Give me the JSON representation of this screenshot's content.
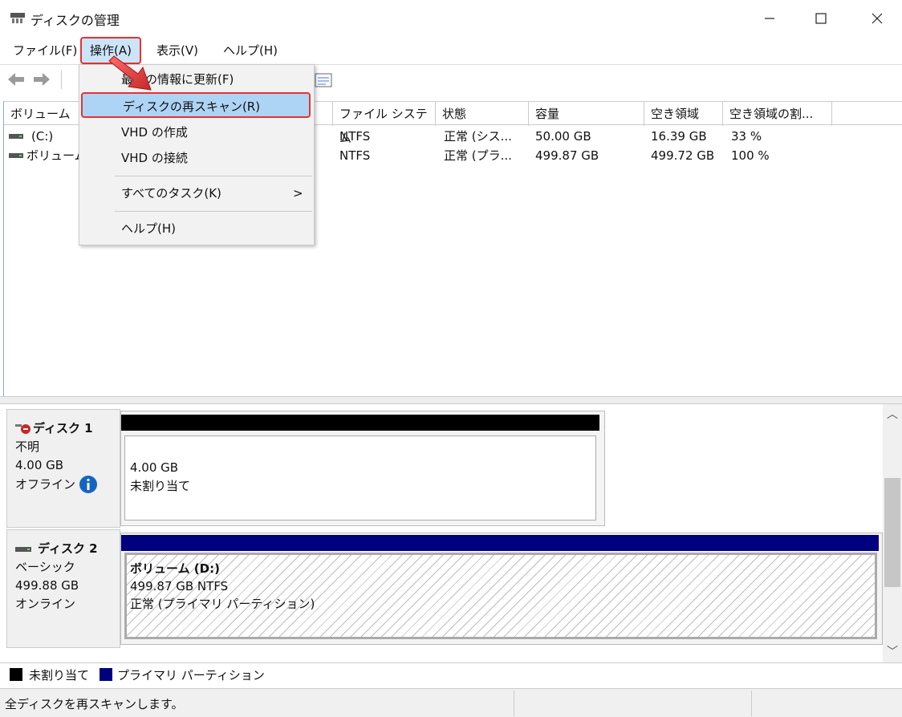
{
  "window": {
    "title": "ディスクの管理",
    "controls": {
      "minimize": "—",
      "maximize": "☐",
      "close": "✕"
    }
  },
  "menubar": {
    "items": [
      "ファイル(F)",
      "操作(A)",
      "表示(V)",
      "ヘルプ(H)"
    ]
  },
  "action_menu": {
    "items": [
      {
        "label": "最新の情報に更新(F)"
      },
      {
        "label": "ディスクの再スキャン(R)"
      },
      {
        "label": "VHD の作成"
      },
      {
        "label": "VHD の接続"
      },
      {
        "label": "すべてのタスク(K)",
        "submenu_indicator": ">"
      },
      {
        "label": "ヘルプ(H)"
      }
    ]
  },
  "volume_list": {
    "columns": [
      "ボリューム",
      "ファイル システム",
      "状態",
      "容量",
      "空き領域",
      "空き領域の割..."
    ],
    "rows": [
      {
        "volume": "(C:)",
        "fs": "NTFS",
        "status": "正常 (シス...",
        "capacity": "50.00 GB",
        "free": "16.39 GB",
        "pct": "33 %"
      },
      {
        "volume": "ボリューム",
        "fs": "NTFS",
        "status": "正常 (プラ...",
        "capacity": "499.87 GB",
        "free": "499.72 GB",
        "pct": "100 %"
      }
    ]
  },
  "disks": [
    {
      "name": "ディスク 1",
      "type": "不明",
      "size": "4.00 GB",
      "state": "オフライン",
      "partition": {
        "size": "4.00 GB",
        "label": "未割り当て"
      }
    },
    {
      "name": "ディスク 2",
      "type": "ベーシック",
      "size": "499.88 GB",
      "state": "オンライン",
      "partition": {
        "title": "ボリューム (D:)",
        "size_fs": "499.87 GB NTFS",
        "status": "正常 (プライマリ パーティション)"
      }
    }
  ],
  "legend": {
    "items": [
      {
        "label": "未割り当て",
        "color": "#000000"
      },
      {
        "label": "プライマリ パーティション",
        "color": "#00007f"
      }
    ]
  },
  "statusbar": {
    "text": "全ディスクを再スキャンします。"
  },
  "colors": {
    "highlight_border": "#e53333",
    "menu_highlight": "#aed4f5",
    "primary_partition": "#00007f"
  }
}
